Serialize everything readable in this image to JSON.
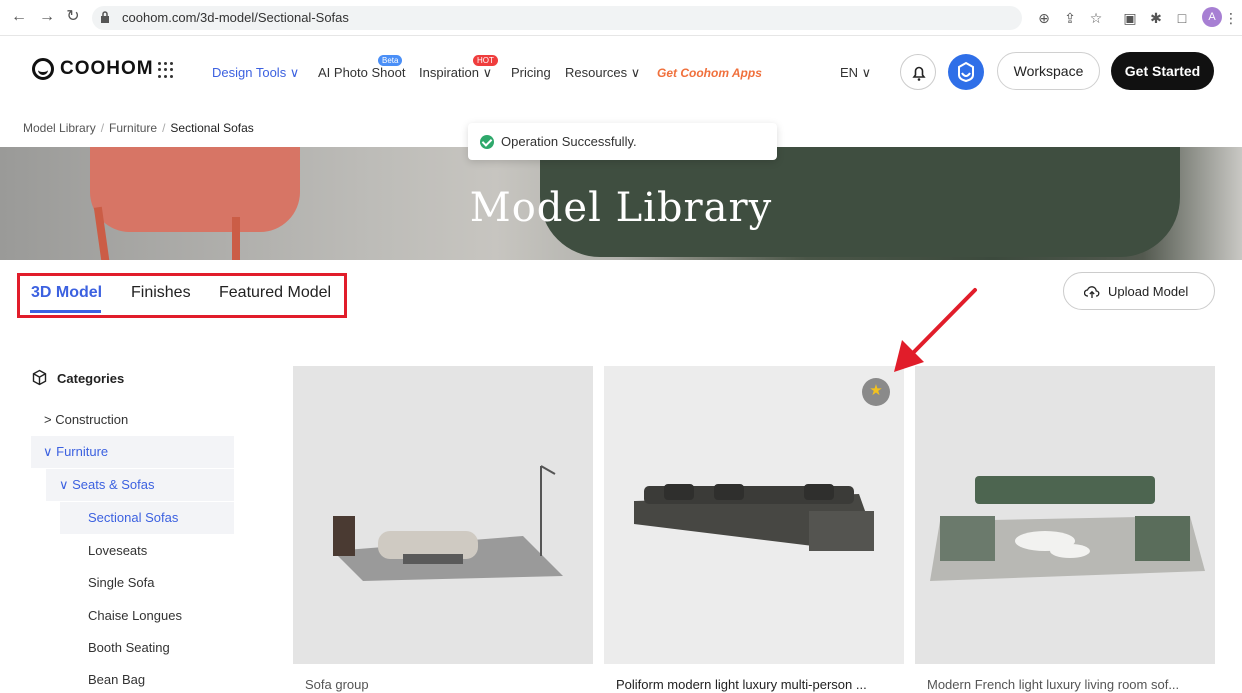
{
  "browser": {
    "url": "coohom.com/3d-model/Sectional-Sofas",
    "avatar_letter": "A",
    "icons": [
      "back-icon",
      "forward-icon",
      "reload-icon",
      "lock-icon",
      "zoom-icon",
      "share-icon",
      "bookmark-star-icon",
      "extension-icon",
      "puzzle-icon",
      "sidebar-icon",
      "menu-icon"
    ]
  },
  "header": {
    "logo_text": "COOHOM",
    "nav": [
      {
        "label": "Design Tools ∨",
        "badge": ""
      },
      {
        "label": "AI Photo Shoot",
        "badge": "Beta"
      },
      {
        "label": "Inspiration ∨",
        "badge": "HOT"
      },
      {
        "label": "Pricing",
        "badge": ""
      },
      {
        "label": "Resources ∨",
        "badge": ""
      },
      {
        "label": "Get Coohom Apps",
        "badge": ""
      }
    ],
    "language": "EN ∨",
    "workspace_label": "Workspace",
    "get_started_label": "Get Started"
  },
  "breadcrumb": [
    "Model Library",
    "Furniture",
    "Sectional Sofas"
  ],
  "toast": {
    "message": "Operation Successfully."
  },
  "banner": {
    "title": "Model Library"
  },
  "tabs": [
    {
      "label": "3D Model",
      "active": true
    },
    {
      "label": "Finishes",
      "active": false
    },
    {
      "label": "Featured Model",
      "active": false
    }
  ],
  "upload_label": "Upload Model",
  "sidebar": {
    "heading": "Categories",
    "items": [
      {
        "label": "> Construction",
        "level": 0
      },
      {
        "label": "∨ Furniture",
        "level": 0
      },
      {
        "label": "∨ Seats & Sofas",
        "level": 1
      },
      {
        "label": "Sectional Sofas",
        "level": 2
      },
      {
        "label": "Loveseats",
        "level": 2
      },
      {
        "label": "Single Sofa",
        "level": 2
      },
      {
        "label": "Chaise Longues",
        "level": 2
      },
      {
        "label": "Booth Seating",
        "level": 2
      },
      {
        "label": "Bean Bag",
        "level": 2
      }
    ]
  },
  "models": [
    {
      "title": "Sofa group"
    },
    {
      "title": "Poliform modern light luxury multi-person ..."
    },
    {
      "title": "Modern French light luxury living room sof..."
    }
  ],
  "colors": {
    "accent": "#3c61e0",
    "highlight_box": "#e11d2a",
    "apps_link": "#f0703c",
    "star": "#f3c21e"
  }
}
